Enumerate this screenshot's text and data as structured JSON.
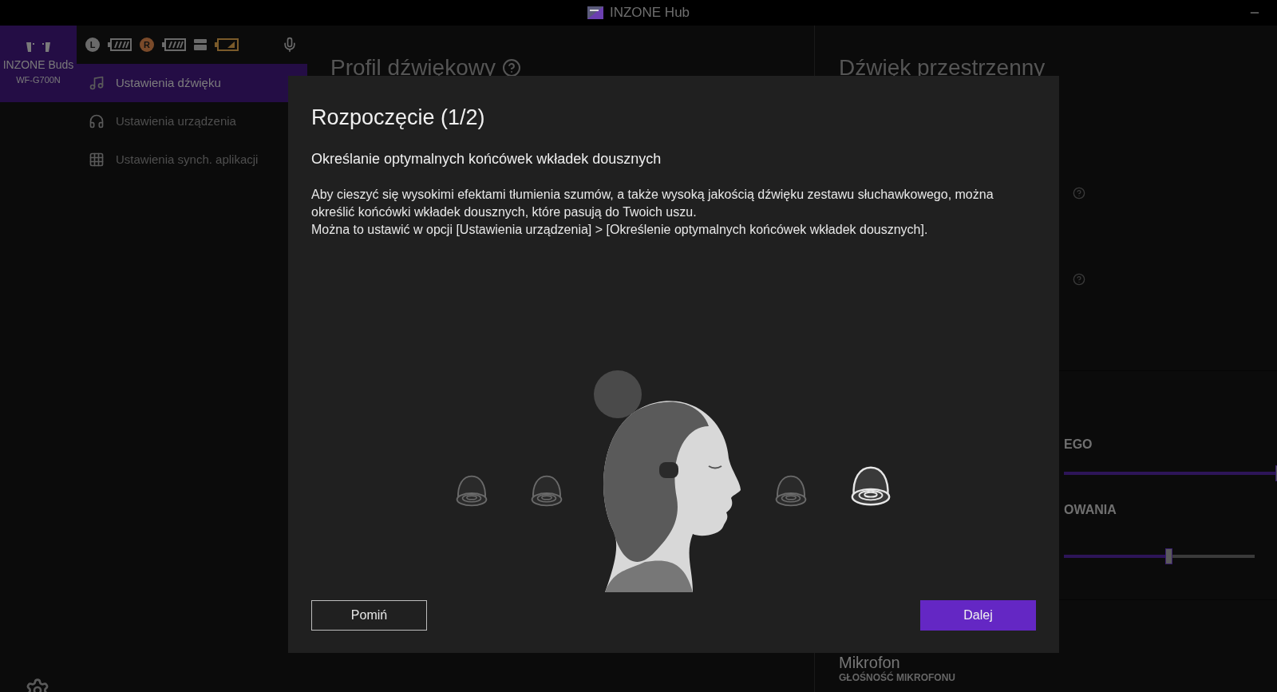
{
  "window": {
    "title": "INZONE Hub"
  },
  "device": {
    "name": "INZONE Buds",
    "model": "WF-G700N",
    "selected": true
  },
  "status": {
    "left_label": "L",
    "right_label": "R"
  },
  "nav": [
    {
      "label": "Ustawienia dźwięku",
      "selected": true
    },
    {
      "label": "Ustawienia urządzenia",
      "selected": false
    },
    {
      "label": "Ustawienia synch. aplikacji",
      "selected": false
    }
  ],
  "main": {
    "title": "Profil dźwiękowy"
  },
  "right_panel": {
    "title": "Dźwięk przestrzenny",
    "label_1": "EGO",
    "label_2": "OWANIA",
    "section": "Mikrofon",
    "section_label": "GŁOŚNOŚĆ MIKROFONU",
    "sliders": [
      {
        "level": 0.97
      },
      {
        "level": 0.55
      }
    ]
  },
  "dialog": {
    "title": "Rozpoczęcie (1/2)",
    "subtitle": "Określanie optymalnych końcówek wkładek dousznych",
    "paragraphs": [
      "Aby cieszyć się wysokimi efektami tłumienia szumów, a także wysoką jakością dźwięku zestawu słuchawkowego, można określić końcówki wkładek dousznych, które pasują do Twoich uszu.",
      "Można to ustawić w opcji [Ustawienia urządzenia] > [Określenie optymalnych końcówek wkładek dousznych]."
    ],
    "eartips": [
      {
        "selected": false
      },
      {
        "selected": false
      },
      {
        "selected": false
      },
      {
        "selected": true
      }
    ],
    "skip_button": "Pomiń",
    "next_button": "Dalej"
  }
}
